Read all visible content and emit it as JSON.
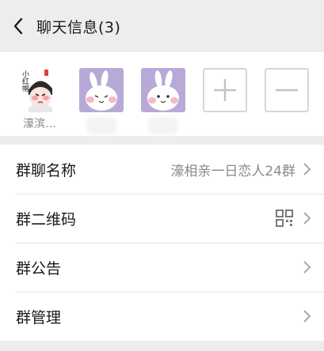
{
  "header": {
    "title": "聊天信息(3)",
    "back_icon": "chevron-left-icon"
  },
  "members": [
    {
      "name": "濠滨…",
      "avatar_icon": "red-hat-cartoon-avatar"
    },
    {
      "name": "",
      "avatar_icon": "white-bunny-avatar"
    },
    {
      "name": "",
      "avatar_icon": "white-bunny-avatar"
    }
  ],
  "actions": {
    "add_icon": "plus-icon",
    "remove_icon": "minus-icon"
  },
  "settings": [
    {
      "label": "群聊名称",
      "value": "濠相亲一日恋人24群"
    },
    {
      "label": "群二维码",
      "value": "",
      "icon": "qr-code-icon"
    },
    {
      "label": "群公告",
      "value": ""
    },
    {
      "label": "群管理",
      "value": ""
    }
  ],
  "colors": {
    "background": "#ededed",
    "avatar_purple": "#b9a9d8",
    "text_secondary": "#8a8a8a"
  }
}
